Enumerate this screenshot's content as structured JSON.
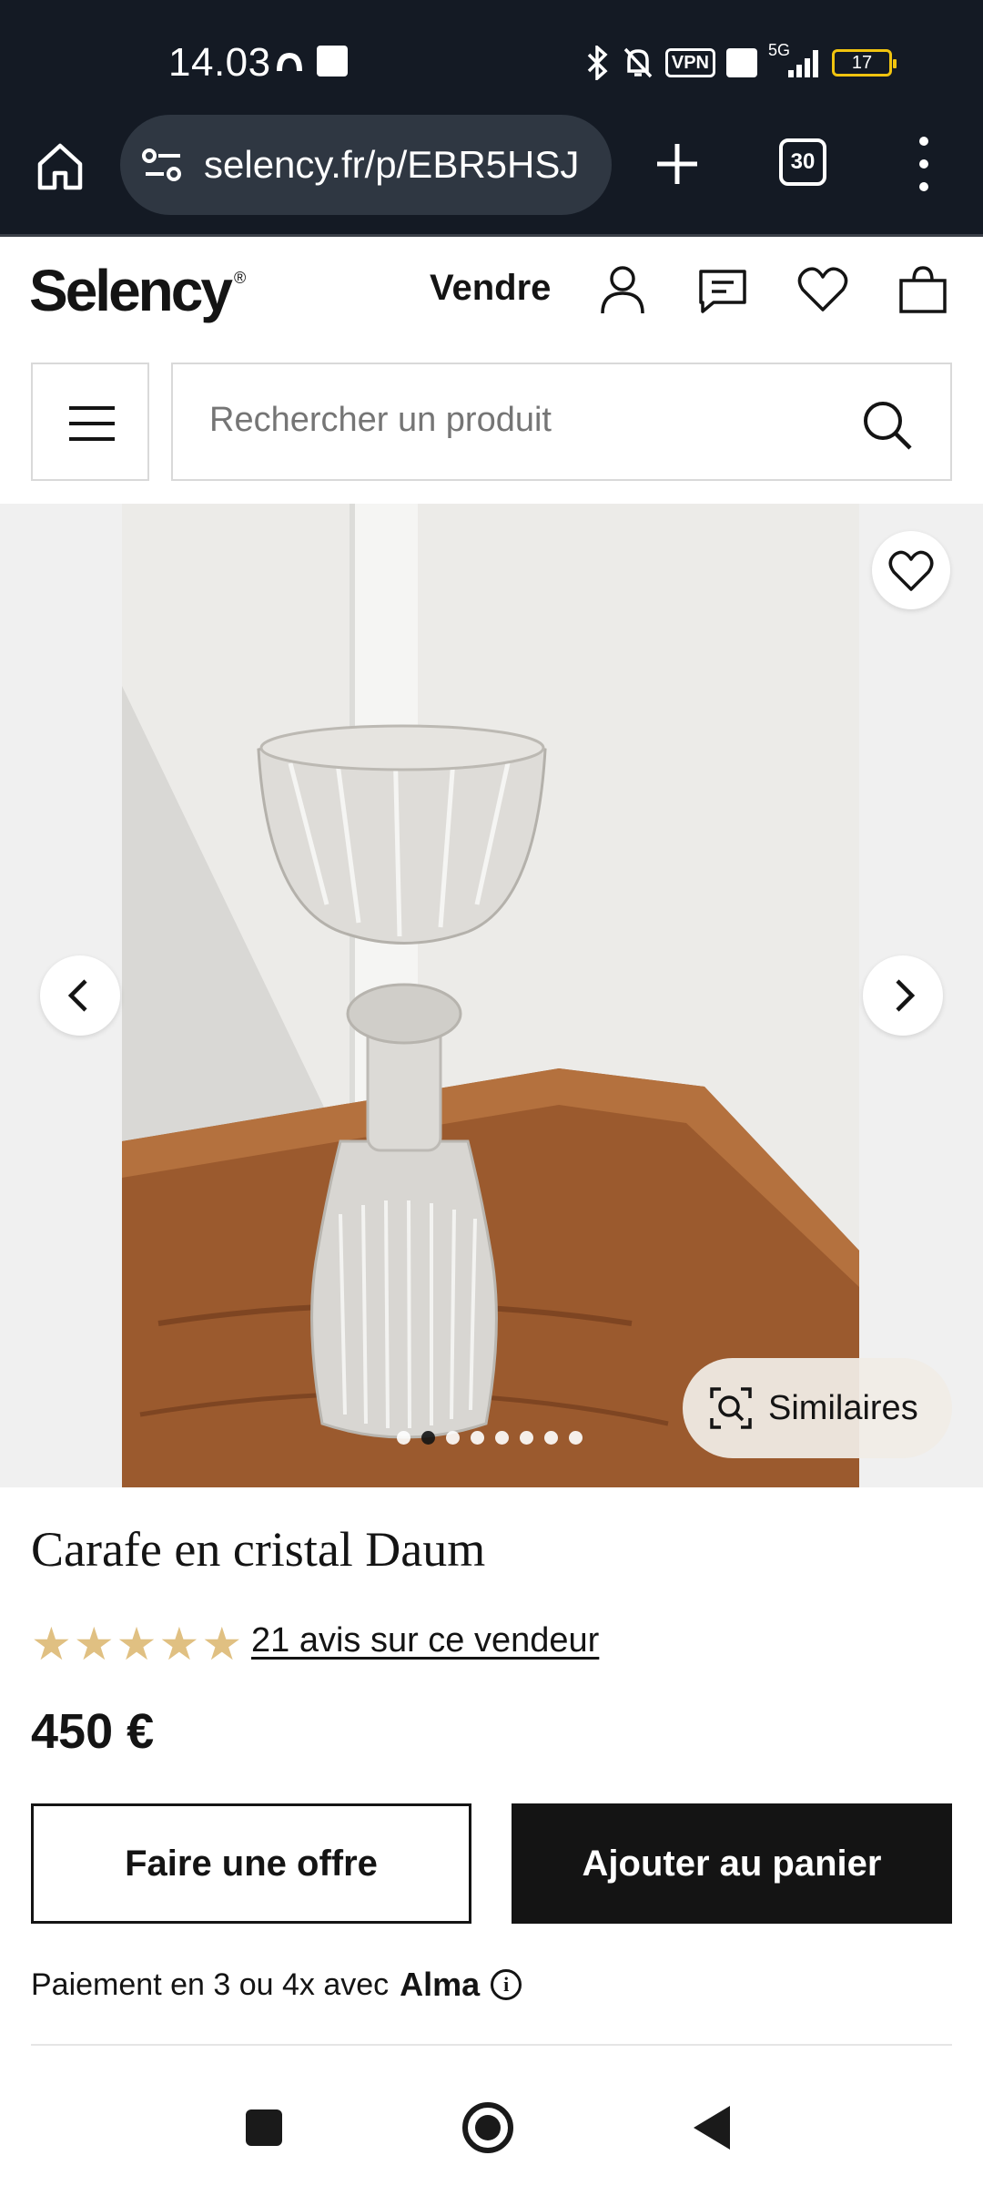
{
  "status_bar": {
    "time": "14.03",
    "icons": [
      "cloud-icon",
      "square-icon",
      "bluetooth-icon",
      "bell-off-icon",
      "vpn-icon",
      "volte-icon",
      "5g-signal-icon",
      "battery-icon"
    ],
    "vpn_label": "VPN",
    "network_label": "5G",
    "battery_level": "17",
    "battery_color": "#f1c40f"
  },
  "browser": {
    "url": "selency.fr/p/EBR5HSJ",
    "tab_count": "30",
    "icons": [
      "home-icon",
      "site-settings-icon",
      "new-tab-icon",
      "tabs-icon",
      "more-icon"
    ]
  },
  "header": {
    "logo": "Selency",
    "logo_mark": "®",
    "sell_label": "Vendre",
    "icons": [
      "account-icon",
      "messages-icon",
      "favorites-icon",
      "cart-icon"
    ]
  },
  "search": {
    "placeholder": "Rechercher un produit"
  },
  "gallery": {
    "similar_label": "Similaires",
    "image_count": 8,
    "active_index": 1,
    "icons": [
      "heart-icon",
      "chevron-left-icon",
      "chevron-right-icon",
      "visual-search-icon"
    ]
  },
  "product": {
    "title": "Carafe en cristal Daum",
    "rating": 5,
    "star_color": "#e0c082",
    "reviews_label": "21 avis sur ce vendeur",
    "price": "450 €",
    "offer_button": "Faire une offre",
    "cart_button": "Ajouter au panier",
    "payment_text": "Paiement en 3 ou 4x avec",
    "payment_provider": "Alma",
    "info_glyph": "i"
  },
  "navbar": {
    "icons": [
      "recents-icon",
      "home-circle-icon",
      "back-icon"
    ]
  }
}
